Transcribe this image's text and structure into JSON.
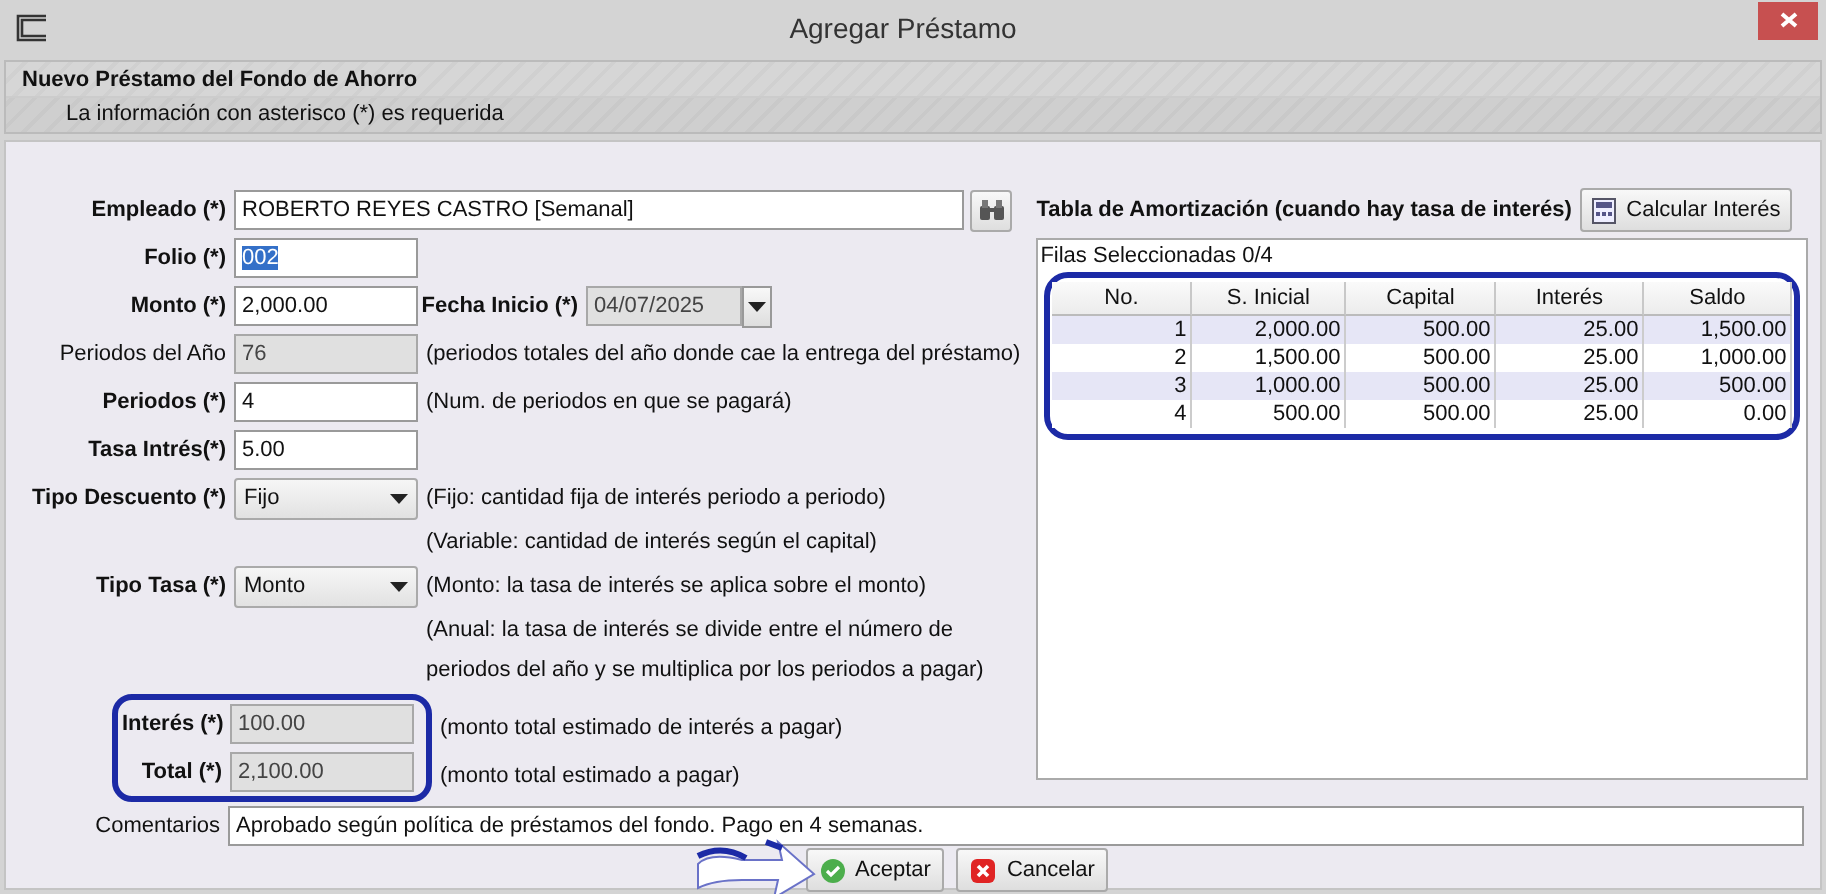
{
  "window": {
    "title": "Agregar Préstamo"
  },
  "header": {
    "title": "Nuevo Préstamo del Fondo de Ahorro",
    "subtitle": "La información con asterisco (*) es requerida"
  },
  "fields": [
    {
      "kind": "lookup",
      "label": "Empleado (*)",
      "value": "ROBERTO REYES CASTRO [Semanal]",
      "required": true
    },
    {
      "kind": "text",
      "label": "Folio (*)",
      "value": "002",
      "required": true,
      "text_selected": true
    },
    {
      "kind": "date",
      "label": "Monto (*)",
      "value": "2,000.00",
      "required": true,
      "date_label": "Fecha Inicio (*)",
      "date_value": "04/07/2025"
    },
    {
      "kind": "text",
      "label": "Periodos del Año",
      "value": "76",
      "required": false,
      "readonly": true,
      "notes": [
        "(periodos totales del año donde cae la entrega del préstamo)"
      ]
    },
    {
      "kind": "text",
      "label": "Periodos (*)",
      "value": "4",
      "required": true,
      "notes": [
        "(Num. de periodos en que se pagará)"
      ]
    },
    {
      "kind": "text",
      "label": "Tasa Intrés(*)",
      "value": "5.00",
      "required": true
    },
    {
      "kind": "combo",
      "label": "Tipo Descuento (*)",
      "value": "Fijo",
      "required": true,
      "notes": [
        "(Fijo: cantidad fija de interés periodo a periodo)",
        "(Variable: cantidad de interés según el capital)"
      ]
    },
    {
      "kind": "combo",
      "label": "Tipo Tasa (*)",
      "value": "Monto",
      "required": true,
      "notes": [
        "(Monto: la tasa de interés se aplica sobre el monto)",
        "(Anual: la tasa de interés se divide entre el número de",
        "periodos del año y se multiplica por los periodos a pagar)"
      ]
    }
  ],
  "totals": [
    {
      "label": "Interés (*)",
      "value": "100.00",
      "readonly": true,
      "note": "(monto total estimado de interés a pagar)"
    },
    {
      "label": "Total (*)",
      "value": "2,100.00",
      "readonly": true,
      "note": "(monto total estimado a pagar)"
    }
  ],
  "comments": {
    "label": "Comentarios",
    "value": "Aprobado según política de préstamos del fondo. Pago en 4 semanas."
  },
  "amortization": {
    "title": "Tabla de Amortización (cuando hay tasa de interés)",
    "button": "Calcular Interés",
    "selection": "Filas Seleccionadas  0/4",
    "columns": [
      "No.",
      "S. Inicial",
      "Capital",
      "Interés",
      "Saldo"
    ],
    "rows": [
      [
        "1",
        "2,000.00",
        "500.00",
        "25.00",
        "1,500.00"
      ],
      [
        "2",
        "1,500.00",
        "500.00",
        "25.00",
        "1,000.00"
      ],
      [
        "3",
        "1,000.00",
        "500.00",
        "25.00",
        "500.00"
      ],
      [
        "4",
        "500.00",
        "500.00",
        "25.00",
        "0.00"
      ]
    ]
  },
  "buttons": [
    {
      "kind": "accept",
      "label": "Aceptar"
    },
    {
      "kind": "cancel",
      "label": "Cancelar"
    }
  ]
}
